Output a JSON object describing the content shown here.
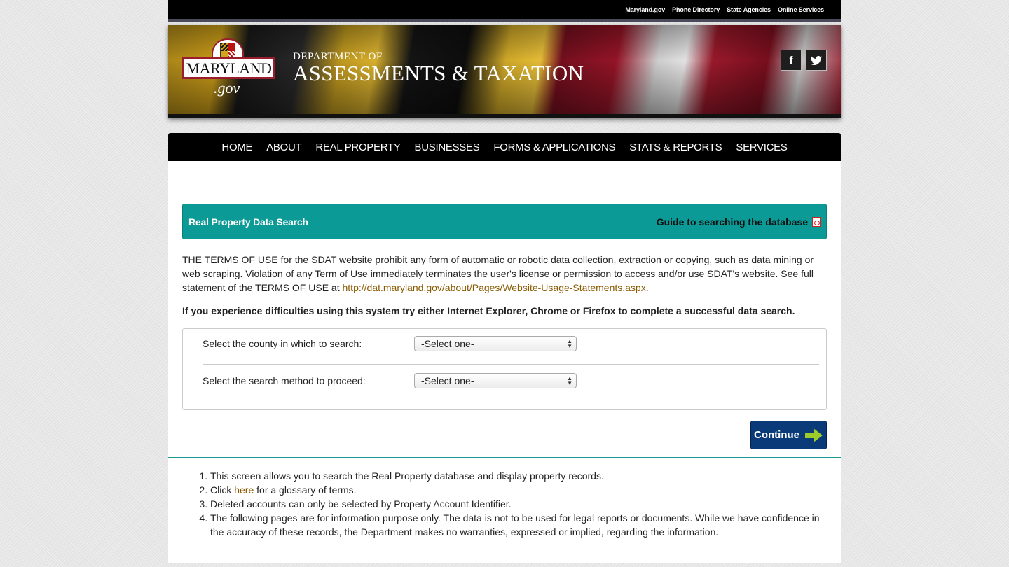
{
  "utility_links": [
    "Maryland.gov",
    "Phone Directory",
    "State Agencies",
    "Online Services"
  ],
  "banner": {
    "logo_text": "MARYLAND",
    "logo_gov": ".gov",
    "dept_line1": "DEPARTMENT OF",
    "dept_line2": "ASSESSMENTS & TAXATION",
    "facebook_glyph": "f",
    "twitter_glyph": "🐦"
  },
  "nav": [
    "HOME",
    "ABOUT",
    "REAL PROPERTY",
    "BUSINESSES",
    "FORMS & APPLICATIONS",
    "STATS & REPORTS",
    "SERVICES"
  ],
  "panel": {
    "title": "Real Property Data Search",
    "guide_label": "Guide to searching the database"
  },
  "terms": {
    "text": "THE TERMS OF USE for the SDAT website prohibit any form of automatic or robotic data collection, extraction or copying, such as data mining or web scraping. Violation of any Term of Use immediately terminates the user's license or permission to access and/or use SDAT's website. See full statement of the TERMS OF USE at ",
    "link": "http://dat.maryland.gov/about/Pages/Website-Usage-Statements.aspx",
    "end": "."
  },
  "notice": "If you experience difficulties using this system try either Internet Explorer, Chrome or Firefox to complete a successful data search.",
  "form": {
    "county_label": "Select the county in which to search:",
    "county_value": "-Select one-",
    "method_label": "Select the search method to proceed:",
    "method_value": "-Select one-"
  },
  "continue_label": "Continue",
  "notes": {
    "item1": "This screen allows you to search the Real Property database and display property records.",
    "item2_pre": "Click ",
    "item2_link": "here",
    "item2_post": " for a glossary of terms.",
    "item3": "Deleted accounts can only be selected by Property Account Identifier.",
    "item4": "The following pages are for information purpose only. The data is not to be used for legal reports or documents. While we have confidence in the accuracy of these records, the Department makes no warranties, expressed or implied, regarding the information."
  },
  "colors": {
    "teal": "#0b9a96",
    "navy": "#0a3a78",
    "link": "#8a5a00"
  }
}
